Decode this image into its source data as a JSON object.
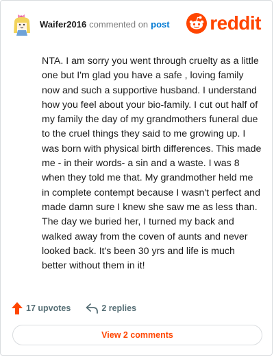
{
  "comment": {
    "username": "Waifer2016",
    "commented_on": "commented on",
    "target_link": "post",
    "body": "NTA. I am sorry you went through cruelty as a little one but I'm glad you have a safe , loving family now and such a supportive husband. I understand how you feel about your bio-family. I cut out half of my family the day of my grandmothers funeral due to the cruel things they said to me growing up. I was born with physical birth differences. This made me - in their words- a sin and a waste. I was 8 when they told me that. My grandmother held me in complete contempt because I wasn't perfect and made damn sure I knew she saw me as less than. The day we buried her, I turned my back and walked away from the coven of aunts and never looked back. It's been 30 yrs and life is much better without them in it!",
    "upvotes": "17 upvotes",
    "replies": "2 replies"
  },
  "brand": {
    "name": "reddit",
    "color": "#ff4500",
    "icon": "reddit-snoo-icon"
  },
  "footer": {
    "view_comments": "View 2 comments"
  },
  "colors": {
    "accent": "#ff4500",
    "link": "#0079d3",
    "muted": "#576f76"
  }
}
